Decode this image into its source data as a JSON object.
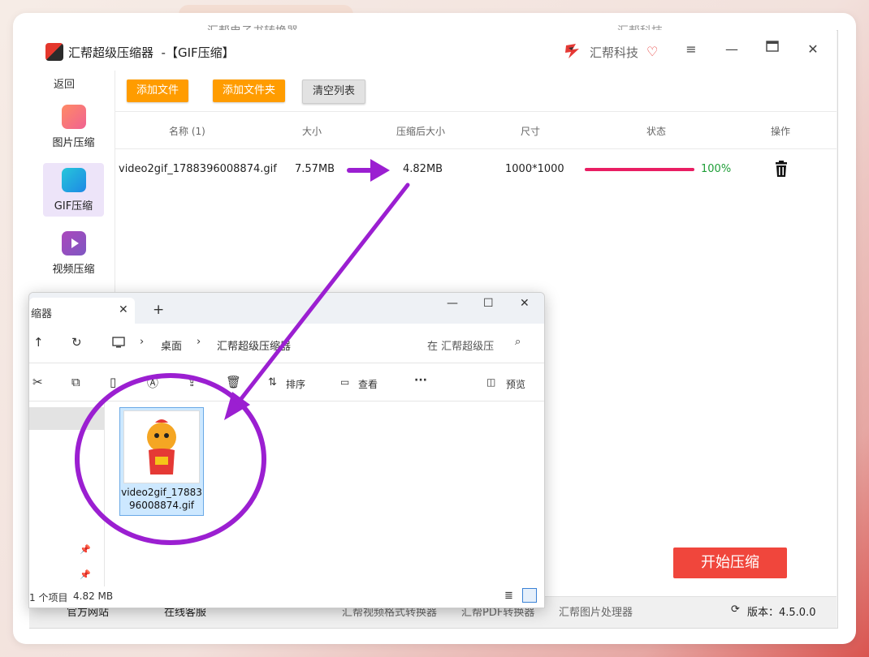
{
  "background_app": {
    "tab_text": "汇帮电子书转换器",
    "right_text": "汇帮科技"
  },
  "app": {
    "title": "汇帮超级压缩器  -【GIF压缩】",
    "brand": "汇帮科技",
    "back_label": "返回",
    "sidebar": [
      {
        "label": "图片压缩",
        "icon": "image-icon"
      },
      {
        "label": "GIF压缩",
        "icon": "gif-icon",
        "active": true
      },
      {
        "label": "视频压缩",
        "icon": "video-icon"
      }
    ],
    "toolbar": {
      "add_file": "添加文件",
      "add_folder": "添加文件夹",
      "clear_list": "清空列表"
    },
    "columns": {
      "name": "名称 (1)",
      "size": "大小",
      "compressed": "压缩后大小",
      "dims": "尺寸",
      "status": "状态",
      "action": "操作"
    },
    "row": {
      "name": "video2gif_1788396008874.gif",
      "size": "7.57MB",
      "compressed": "4.82MB",
      "dims": "1000*1000",
      "progress": "100%"
    },
    "start_button": "开始压缩",
    "footer": {
      "website": "官方网站",
      "service": "在线客服",
      "app1": "汇帮视频格式转换器",
      "app2": "汇帮PDF转换器",
      "app3": "汇帮图片处理器",
      "version": "版本：4.5.0.0"
    },
    "accent_color": "#ff9c00",
    "progress_color": "#e91e63"
  },
  "explorer": {
    "tab_label": "缩器",
    "breadcrumb": [
      "桌面",
      "汇帮超级压缩器"
    ],
    "search_placeholder": "在 汇帮超级压",
    "cmd": {
      "sort": "排序",
      "view": "查看",
      "more": "···",
      "preview": "预览"
    },
    "file": {
      "name": "video2gif_1788396008874.gif"
    },
    "status": {
      "count": "1 个项目",
      "size": "4.82 MB"
    }
  },
  "annotation_color": "#9b1fd1"
}
